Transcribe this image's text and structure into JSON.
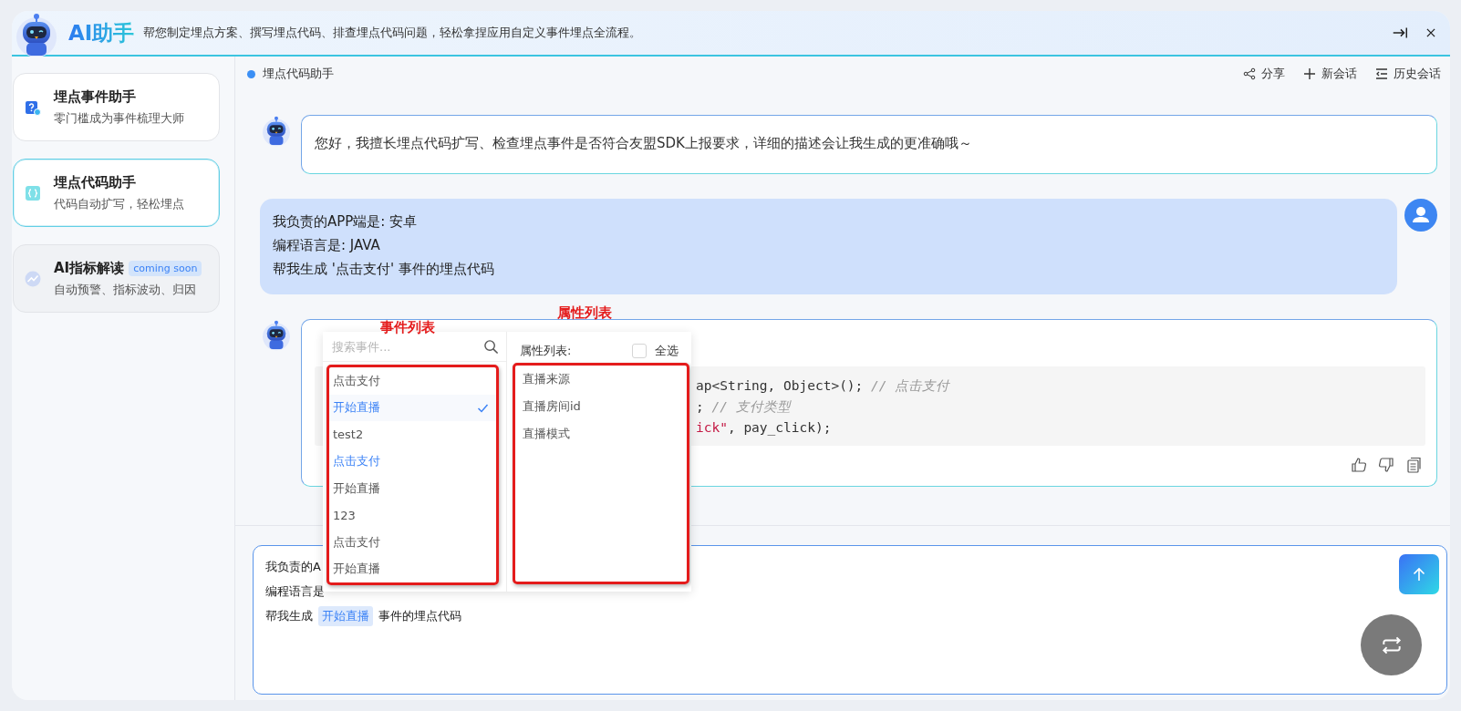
{
  "header": {
    "title": "AI助手",
    "subtitle": "帮您制定埋点方案、撰写埋点代码、排查埋点代码问题，轻松拿捏应用自定义事件埋点全流程。"
  },
  "sidebar": {
    "items": [
      {
        "kind": "events",
        "title": "埋点事件助手",
        "desc": "零门槛成为事件梳理大师",
        "selected": false,
        "disabled": false
      },
      {
        "kind": "code",
        "title": "埋点代码助手",
        "desc": "代码自动扩写，轻松埋点",
        "selected": true,
        "disabled": false
      },
      {
        "kind": "metrics",
        "title": "AI指标解读",
        "badge": "coming soon",
        "desc": "自动预警、指标波动、归因",
        "selected": false,
        "disabled": true
      }
    ]
  },
  "topbar": {
    "title": "埋点代码助手",
    "actions": [
      {
        "kind": "share",
        "label": "分享"
      },
      {
        "kind": "plus",
        "label": "新会话"
      },
      {
        "kind": "history",
        "label": "历史会话"
      }
    ]
  },
  "messages": [
    {
      "kind": "bot",
      "lines": [
        "您好，我擅长埋点代码扩写、检查埋点事件是否符合友盟SDK上报要求，详细的描述会让我生成的更准确哦～"
      ]
    },
    {
      "kind": "user",
      "lines": [
        "我负责的APP端是: 安卓",
        "编程语言是: JAVA",
        "帮我生成 '点击支付' 事件的埋点代码"
      ]
    },
    {
      "kind": "bot",
      "code": [
        [
          {
            "kind": "plain",
            "text": "ap<String, Object>(); "
          },
          {
            "kind": "comment",
            "text": "// 点击支付"
          }
        ],
        [
          {
            "kind": "plain",
            "text": "; "
          },
          {
            "kind": "comment",
            "text": "// 支付类型"
          }
        ],
        [
          {
            "kind": "string",
            "text": "ick\""
          },
          {
            "kind": "plain",
            "text": ", pay_click);"
          }
        ]
      ]
    }
  ],
  "input": {
    "lines": [
      [
        {
          "kind": "text",
          "text": "我负责的A"
        }
      ],
      [
        {
          "kind": "text",
          "text": "编程语言是"
        }
      ],
      [
        {
          "kind": "text",
          "text": "帮我生成"
        },
        {
          "kind": "tag",
          "text": "开始直播"
        },
        {
          "kind": "text",
          "text": "事件的埋点代码"
        }
      ]
    ]
  },
  "popover": {
    "search_placeholder": "搜索事件...",
    "events": [
      {
        "label": "点击支付",
        "selected": false,
        "highlighted": false
      },
      {
        "label": "开始直播",
        "selected": true,
        "highlighted": true
      },
      {
        "label": "test2",
        "selected": false,
        "highlighted": false
      },
      {
        "label": "点击支付",
        "selected": false,
        "highlighted": true
      },
      {
        "label": "开始直播",
        "selected": false,
        "highlighted": false
      },
      {
        "label": "123",
        "selected": false,
        "highlighted": false
      },
      {
        "label": "点击支付",
        "selected": false,
        "highlighted": false
      },
      {
        "label": "开始直播",
        "selected": false,
        "highlighted": false
      }
    ],
    "props_title": "属性列表:",
    "select_all": {
      "label": "全选",
      "checked": false
    },
    "props": [
      "直播来源",
      "直播房间id",
      "直播模式"
    ]
  },
  "annotations": [
    {
      "label": "事件列表"
    },
    {
      "label": "属性列表"
    }
  ]
}
